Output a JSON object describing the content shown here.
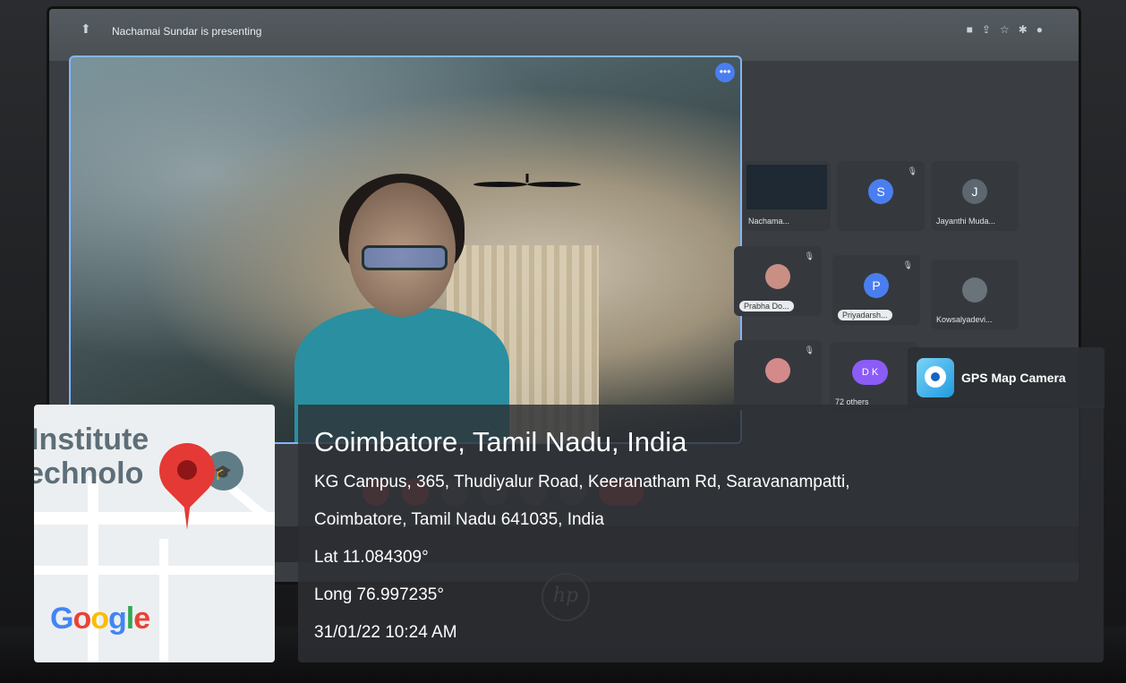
{
  "meet": {
    "presenting_text": "Nachamai Sundar is presenting",
    "tiles": [
      {
        "name": "Nachama...",
        "initial": ""
      },
      {
        "name": "",
        "initial": "S"
      },
      {
        "name": "Jayanthi Muda...",
        "initial": "J"
      },
      {
        "name": "Prabha Do...",
        "initial": ""
      },
      {
        "name": "Priyadarsh...",
        "initial": "P"
      },
      {
        "name": "Kowsalyadevi...",
        "initial": ""
      },
      {
        "name": "",
        "initial": ""
      },
      {
        "name": "72 others",
        "initial": "D K"
      }
    ],
    "screen_colors": {
      "accent": "#4a7ef0",
      "frame": "#7fb7ff"
    }
  },
  "laptop": {
    "brand_logo": "hp"
  },
  "gps_camera": {
    "app_name": "GPS Map Camera",
    "title": "Coimbatore, Tamil Nadu, India",
    "address_line1": "KG Campus, 365, Thudiyalur Road, Keeranatham Rd, Saravanampatti,",
    "address_line2": "Coimbatore, Tamil Nadu 641035, India",
    "lat": "Lat 11.084309°",
    "long": "Long 76.997235°",
    "datetime": "31/01/22 10:24 AM"
  },
  "map": {
    "label_line1": "Institute",
    "label_line2": "echnolo",
    "google_logo": "Google",
    "pin_color": "#e53935"
  }
}
